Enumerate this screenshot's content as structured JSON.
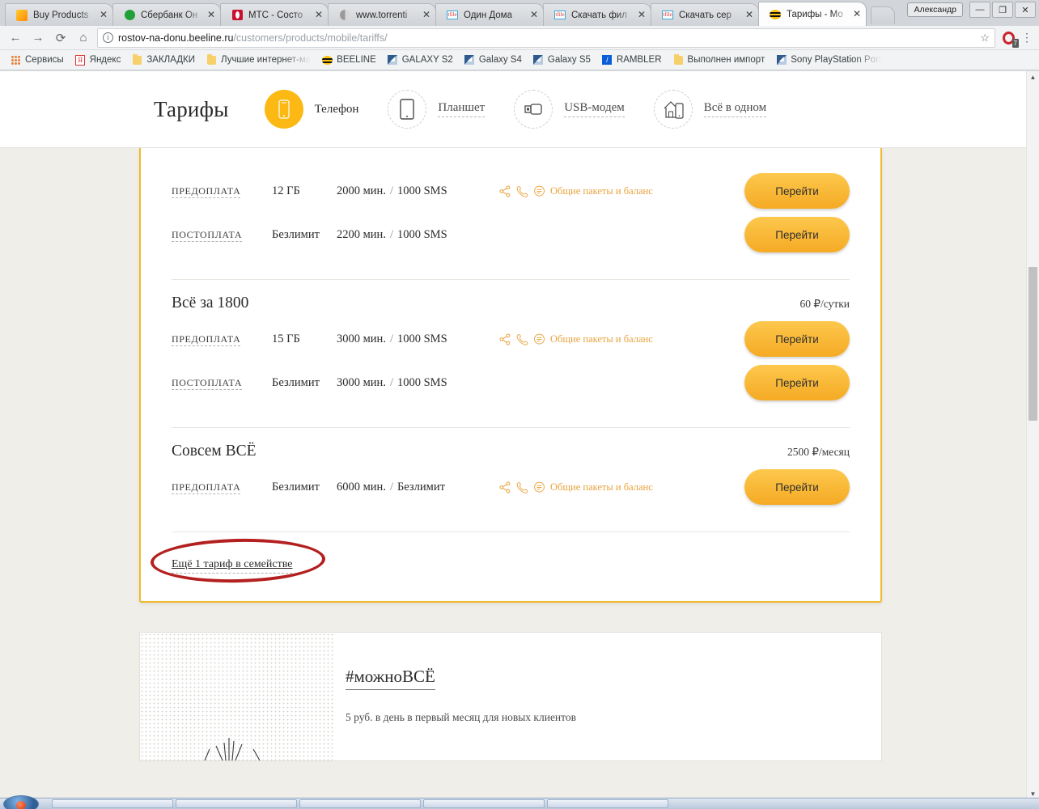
{
  "browser": {
    "user_chip": "Александр",
    "window_controls": [
      "—",
      "❐",
      "✕"
    ],
    "tabs": [
      {
        "title": "Buy Products",
        "favicon": "firefox-icon",
        "active": false
      },
      {
        "title": "Сбербанк Он",
        "favicon": "sberbank-icon",
        "active": false
      },
      {
        "title": "МТС - Состо",
        "favicon": "mts-icon",
        "active": false
      },
      {
        "title": "www.torrenti",
        "favicon": "torrent-icon",
        "active": false
      },
      {
        "title": "Один Дома",
        "favicon": "tfile-icon",
        "active": false
      },
      {
        "title": "Скачать фил",
        "favicon": "tfile-icon",
        "active": false
      },
      {
        "title": "Скачать сер",
        "favicon": "tfile-icon",
        "active": false
      },
      {
        "title": "Тарифы - Мо",
        "favicon": "beeline-icon",
        "active": true
      }
    ],
    "close_glyph": "✕",
    "nav": {
      "back": "←",
      "forward": "→",
      "reload": "⟳",
      "home": "⌂"
    },
    "omnibox": {
      "info_glyph": "i",
      "url_host": "rostov-na-donu.beeline.ru",
      "url_path": "/customers/products/mobile/tariffs/",
      "star_glyph": "☆"
    },
    "extension": {
      "name": "opera-vpn-icon",
      "badge": "7"
    },
    "menu_glyph": "⋮",
    "bookmarks": [
      {
        "label": "Сервисы",
        "icon": "apps-grid-icon",
        "fade": false
      },
      {
        "label": "Яндекс",
        "icon": "yandex-icon",
        "fade": false
      },
      {
        "label": "ЗАКЛАДКИ",
        "icon": "folder-icon",
        "fade": false
      },
      {
        "label": "Лучшие интернет-ма",
        "icon": "folder-icon",
        "fade": true
      },
      {
        "label": "BEELINE",
        "icon": "beeline-icon",
        "fade": false
      },
      {
        "label": "GALAXY S2",
        "icon": "samsung-icon",
        "fade": false
      },
      {
        "label": "Galaxy S4",
        "icon": "samsung-icon",
        "fade": false
      },
      {
        "label": "Galaxy S5",
        "icon": "samsung-icon",
        "fade": false
      },
      {
        "label": "RAMBLER",
        "icon": "rambler-icon",
        "fade": false
      },
      {
        "label": "Выполнен импорт",
        "icon": "folder-icon",
        "fade": false
      },
      {
        "label": "Sony PlayStation Port",
        "icon": "samsung-icon",
        "fade": true
      }
    ]
  },
  "page": {
    "title": "Тарифы",
    "categories": [
      {
        "label": "Телефон",
        "icon": "phone-icon",
        "active": true
      },
      {
        "label": "Планшет",
        "icon": "tablet-icon",
        "active": false
      },
      {
        "label": "USB-модем",
        "icon": "usb-modem-icon",
        "active": false
      },
      {
        "label": "Всё в одном",
        "icon": "home-and-phone-icon",
        "active": false
      }
    ],
    "shared_label": "Общие пакеты и баланс",
    "go_label": "Перейти",
    "groups": [
      {
        "name": "",
        "price": "",
        "partial": true,
        "rows": [
          {
            "type": "ПРЕДОПЛАТА",
            "data": "12 ГБ",
            "minutes": "2000 мин.",
            "sms": "1000 SMS",
            "shared": true
          },
          {
            "type": "ПОСТОПЛАТА",
            "data": "Безлимит",
            "minutes": "2200 мин.",
            "sms": "1000 SMS",
            "shared": false
          }
        ]
      },
      {
        "name": "Всё за 1800",
        "price": "60 ₽/сутки",
        "partial": false,
        "rows": [
          {
            "type": "ПРЕДОПЛАТА",
            "data": "15 ГБ",
            "minutes": "3000 мин.",
            "sms": "1000 SMS",
            "shared": true
          },
          {
            "type": "ПОСТОПЛАТА",
            "data": "Безлимит",
            "minutes": "3000 мин.",
            "sms": "1000 SMS",
            "shared": false
          }
        ]
      },
      {
        "name": "Совсем ВСЁ",
        "price": "2500 ₽/месяц",
        "partial": false,
        "rows": [
          {
            "type": "ПРЕДОПЛАТА",
            "data": "Безлимит",
            "minutes": "6000 мин.",
            "sms": "Безлимит",
            "shared": true
          }
        ]
      }
    ],
    "more_link": "Ещё 1 тариф в семействе",
    "annotation": {
      "shape": "red-ellipse",
      "color": "#b3201f",
      "targets": "more-tariffs-link"
    },
    "promo": {
      "title": "#можноВСЁ",
      "subtitle": "5 руб. в день в первый месяц для новых клиентов"
    }
  },
  "colors": {
    "brand_yellow": "#fcb813",
    "card_border": "#f0b92e",
    "shared_orange": "#e8a33d",
    "annotation_red": "#b3201f",
    "page_bg": "#efeee9"
  }
}
